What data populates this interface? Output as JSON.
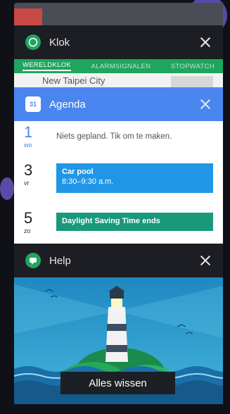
{
  "recents": {
    "klok": {
      "title": "Klok",
      "tabs": [
        "WERELDKLOK",
        "ALARMSIGNALEN",
        "STOPWATCH"
      ],
      "city": "New Taipei City"
    },
    "agenda": {
      "title": "Agenda",
      "icon_label": "31",
      "days": [
        {
          "num": "1",
          "abbr": "wo",
          "empty_text": "Niets gepland. Tik om te maken."
        },
        {
          "num": "3",
          "abbr": "vr",
          "event_title": "Car pool",
          "event_time": "8:30–9:30 a.m.",
          "event_color": "#2196e6"
        },
        {
          "num": "5",
          "abbr": "zo",
          "event_title": "Daylight Saving Time ends",
          "event_color": "#19997a"
        }
      ]
    },
    "help": {
      "title": "Help"
    },
    "clear_all_label": "Alles wissen"
  },
  "colors": {
    "klok_accent": "#1fa55e",
    "agenda_header": "#4a86f0",
    "help_sky": "#2f9ec8"
  }
}
